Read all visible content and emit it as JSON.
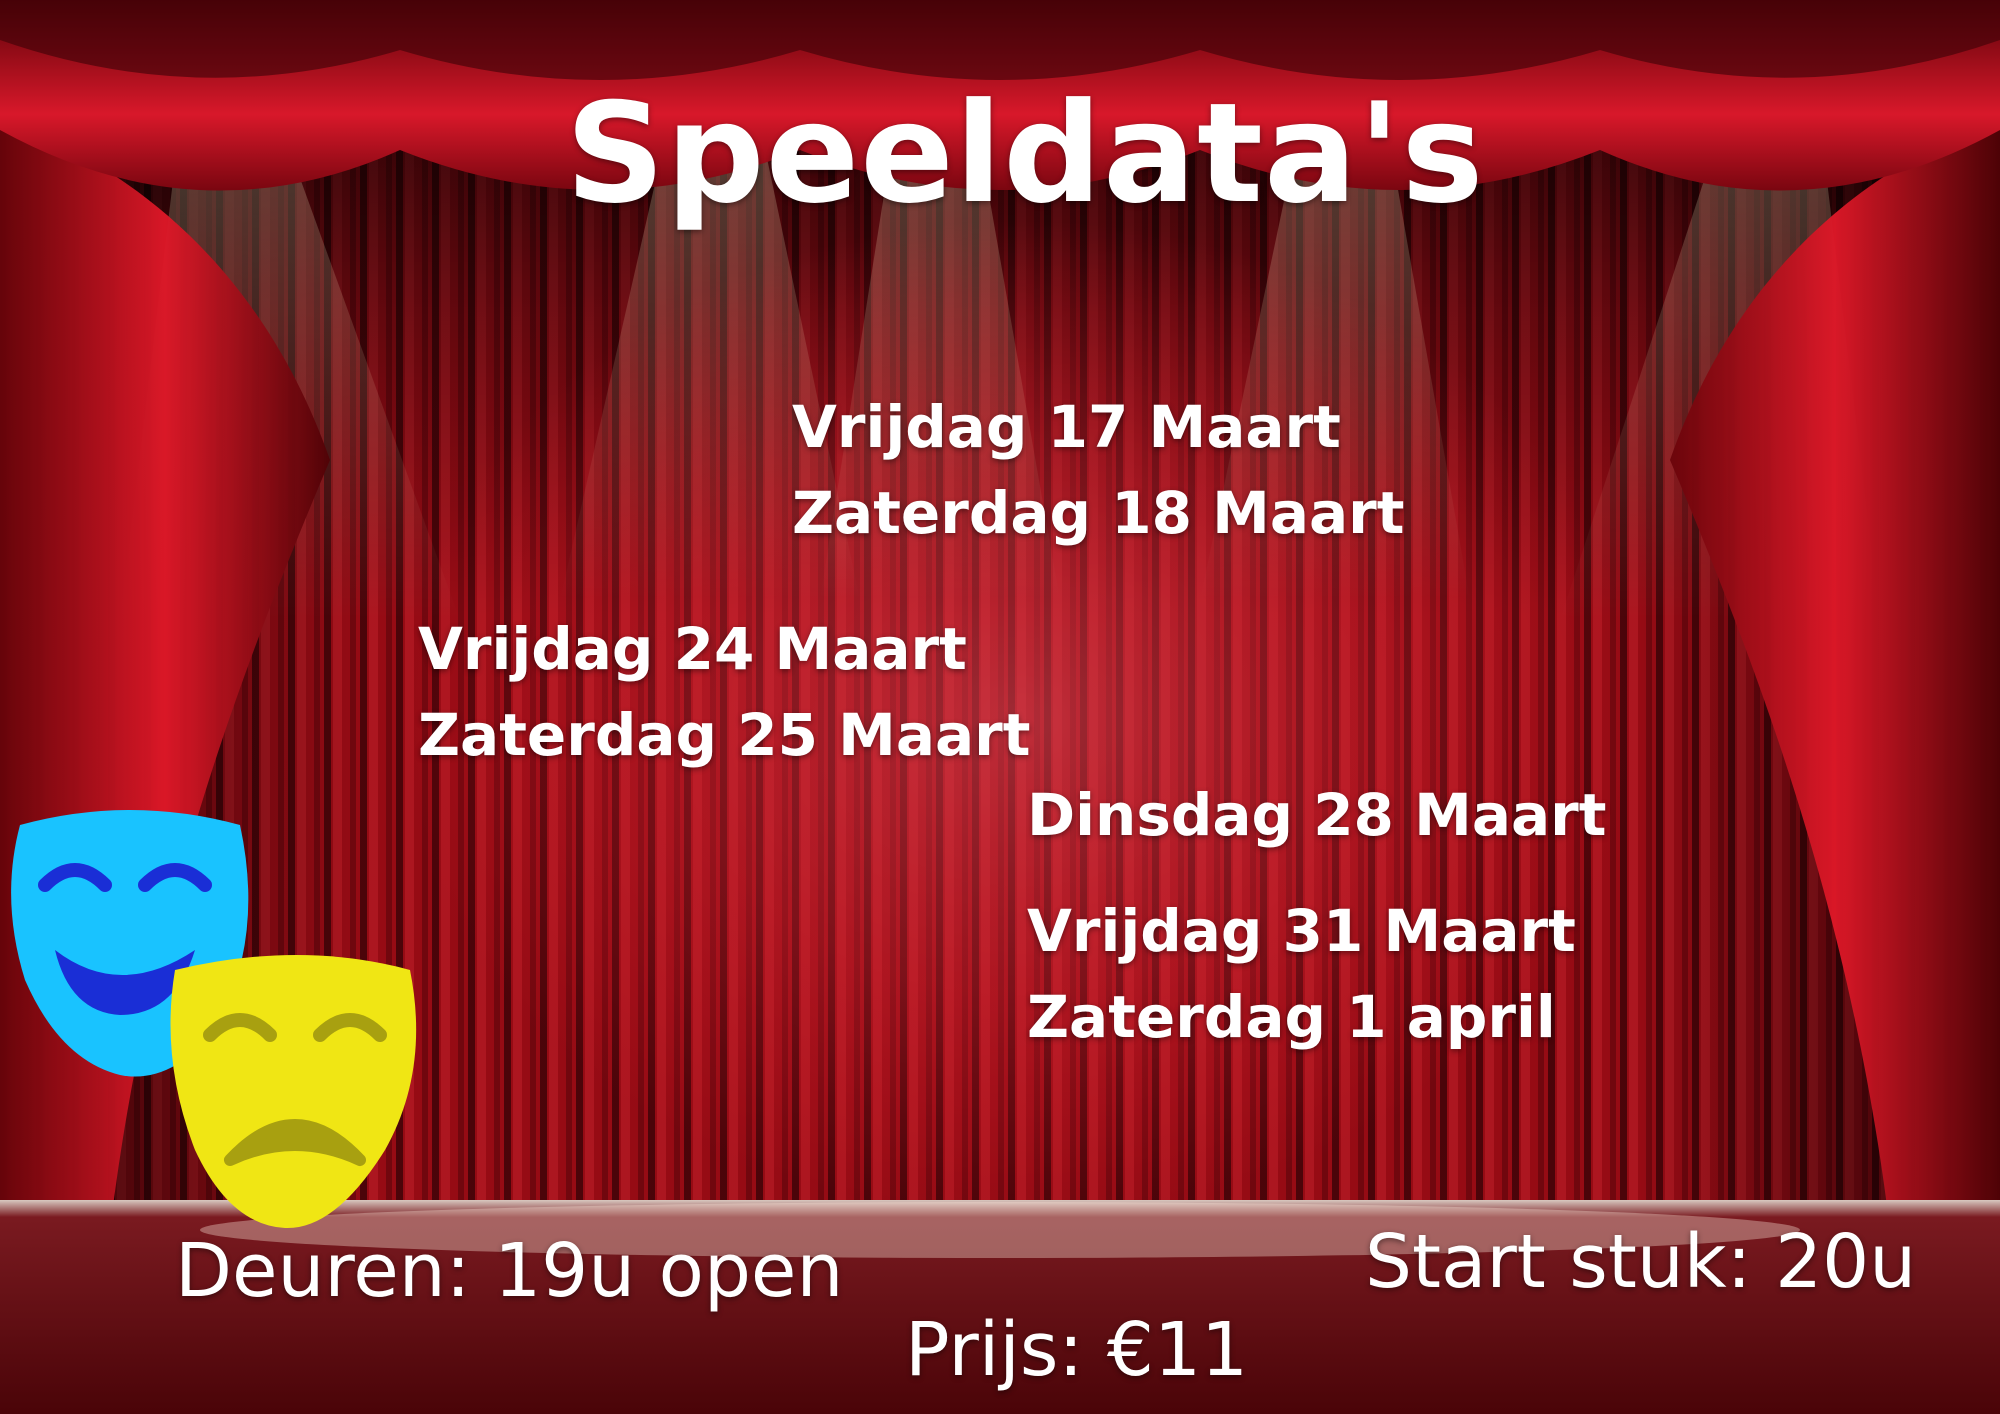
{
  "poster": {
    "title": "Speeldata's",
    "dates": [
      "Vrijdag 17 Maart",
      "Zaterdag 18 Maart",
      "Vrijdag 24 Maart",
      "Zaterdag 25 Maart",
      "Dinsdag 28 Maart",
      "Vrijdag 31 Maart",
      "Zaterdag 1 april"
    ],
    "doors": "Deuren:  19u open",
    "start": "Start stuk: 20u",
    "price": "Prijs: €11"
  },
  "colors": {
    "curtain": "#c4101c",
    "curtain_dark": "#3a0206",
    "spotlight": "#ff4a55",
    "text": "#ffffff",
    "mask_comedy": "#19c3ff",
    "mask_comedy_features": "#1a2ed6",
    "mask_tragedy": "#f0e614",
    "mask_tragedy_features": "#a8a010"
  },
  "icons": [
    "comedy-mask-icon",
    "tragedy-mask-icon"
  ]
}
